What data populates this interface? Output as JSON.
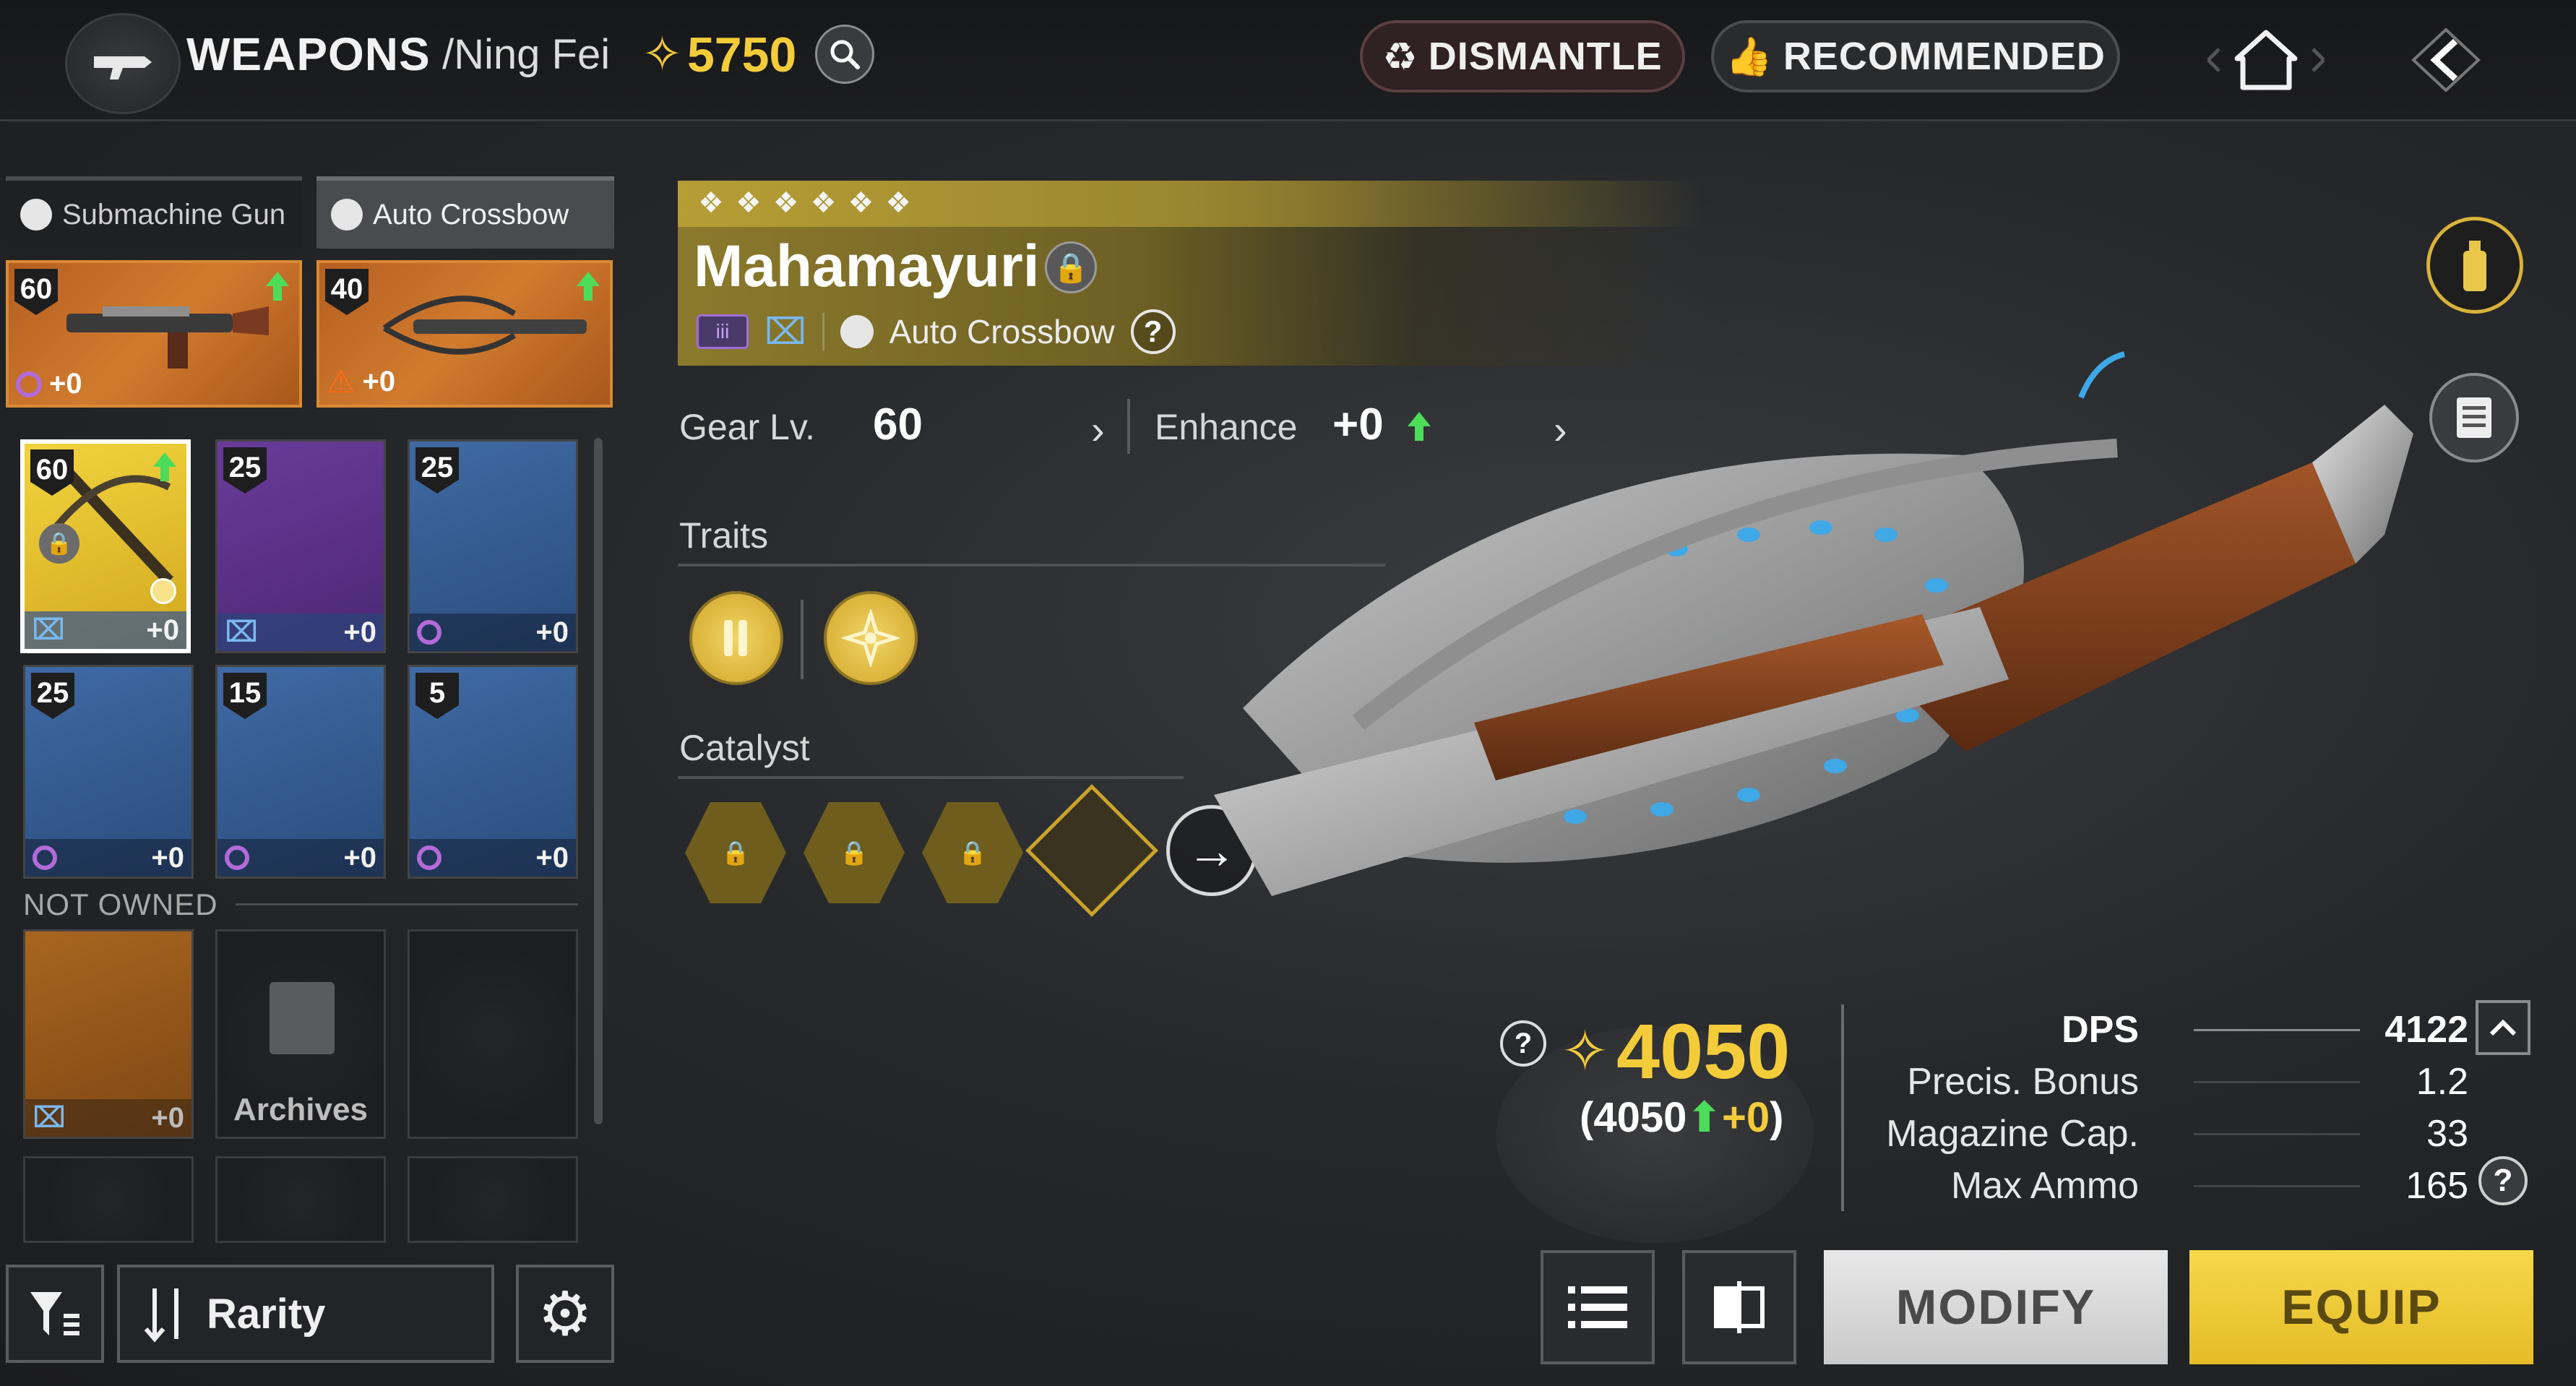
{
  "header": {
    "title": "WEAPONS",
    "character": "/Ning Fei",
    "currency": "5750",
    "dismantle_label": "DISMANTLE",
    "recommended_label": "RECOMMENDED"
  },
  "tabs": [
    {
      "label": "Submachine Gun",
      "level": "60",
      "bonus": "+0"
    },
    {
      "label": "Auto Crossbow",
      "level": "40",
      "bonus": "+0"
    }
  ],
  "inventory": {
    "owned": [
      {
        "level": "60",
        "bonus": "+0",
        "rarity": "gold"
      },
      {
        "level": "25",
        "bonus": "+0",
        "rarity": "purple"
      },
      {
        "level": "25",
        "bonus": "+0",
        "rarity": "blue"
      },
      {
        "level": "25",
        "bonus": "+0",
        "rarity": "blue"
      },
      {
        "level": "15",
        "bonus": "+0",
        "rarity": "blue"
      },
      {
        "level": "5",
        "bonus": "+0",
        "rarity": "blue"
      }
    ],
    "not_owned_label": "NOT OWNED",
    "not_owned_item_bonus": "+0",
    "archives_label": "Archives"
  },
  "sort": {
    "label": "Rarity"
  },
  "weapon": {
    "name": "Mahamayuri",
    "type": "Auto Crossbow",
    "gear_label": "Gear Lv.",
    "gear_value": "60",
    "enhance_label": "Enhance",
    "enhance_value": "+0",
    "traits_label": "Traits",
    "catalyst_label": "Catalyst"
  },
  "power": {
    "value": "4050",
    "breakdown_base": "(4050",
    "breakdown_bonus": "+0",
    "breakdown_close": ")"
  },
  "stats": [
    {
      "label": "DPS",
      "value": "4122"
    },
    {
      "label": "Precis. Bonus",
      "value": "1.2"
    },
    {
      "label": "Magazine Cap.",
      "value": "33"
    },
    {
      "label": "Max Ammo",
      "value": "165"
    }
  ],
  "actions": {
    "modify": "MODIFY",
    "equip": "EQUIP"
  },
  "colors": {
    "gold": "#f4cc3a",
    "accent_green": "#4ddc5a",
    "rarity_gold": "#f1d33d",
    "rarity_blue": "#3f6aa3",
    "rarity_purple": "#6a3b9a"
  }
}
